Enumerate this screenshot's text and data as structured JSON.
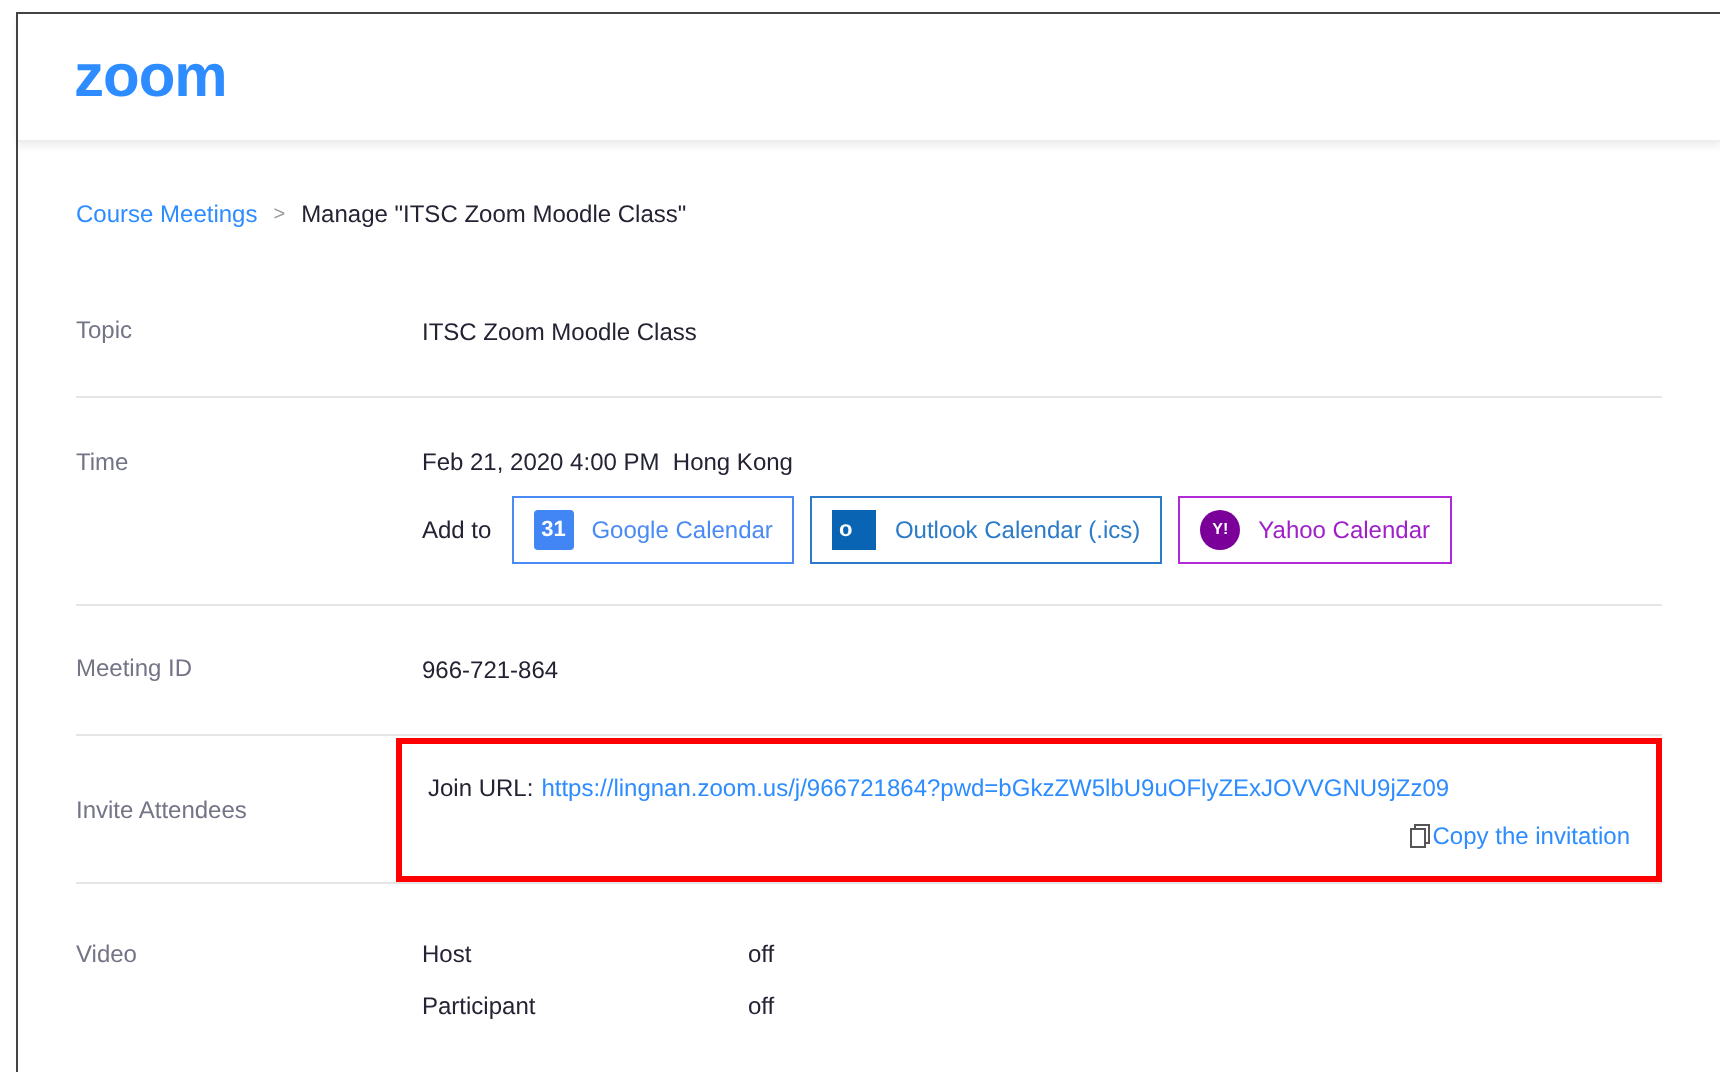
{
  "logo": "zoom",
  "breadcrumb": {
    "link": "Course Meetings",
    "separator": ">",
    "current": "Manage \"ITSC Zoom Moodle Class\""
  },
  "topic": {
    "label": "Topic",
    "value": "ITSC Zoom Moodle Class"
  },
  "time": {
    "label": "Time",
    "value": "Feb 21, 2020 4:00 PM  Hong Kong",
    "add_to": "Add to",
    "calendars": [
      {
        "kind": "google",
        "label": "Google Calendar",
        "icon_text": "31"
      },
      {
        "kind": "outlook",
        "label": "Outlook Calendar (.ics)",
        "icon_text": "o"
      },
      {
        "kind": "yahoo",
        "label": "Yahoo Calendar",
        "icon_text": "Y!"
      }
    ]
  },
  "meeting_id": {
    "label": "Meeting ID",
    "value": "966-721-864"
  },
  "invite": {
    "label": "Invite Attendees",
    "join_label": "Join URL:",
    "url": "https://lingnan.zoom.us/j/966721864?pwd=bGkzZW5lbU9uOFlyZExJOVVGNU9jZz09",
    "copy": "Copy the invitation",
    "highlighted": true
  },
  "video": {
    "label": "Video",
    "rows": [
      {
        "name": "Host",
        "value": "off"
      },
      {
        "name": "Participant",
        "value": "off"
      }
    ]
  }
}
